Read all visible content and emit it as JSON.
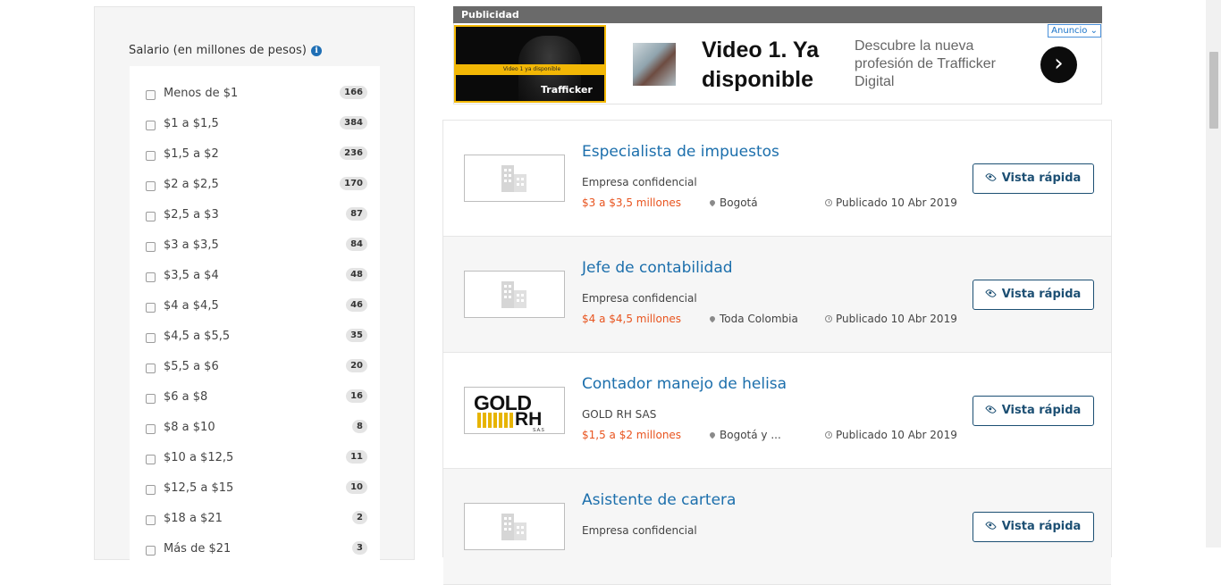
{
  "sidebar": {
    "salary_filter": {
      "title": "Salario (en millones de pesos)",
      "info_icon": "info-icon",
      "options": [
        {
          "label": "Menos de $1",
          "count": "166"
        },
        {
          "label": "$1 a $1,5",
          "count": "384"
        },
        {
          "label": "$1,5 a $2",
          "count": "236"
        },
        {
          "label": "$2 a $2,5",
          "count": "170"
        },
        {
          "label": "$2,5 a $3",
          "count": "87"
        },
        {
          "label": "$3 a $3,5",
          "count": "84"
        },
        {
          "label": "$3,5 a $4",
          "count": "48"
        },
        {
          "label": "$4 a $4,5",
          "count": "46"
        },
        {
          "label": "$4,5 a $5,5",
          "count": "35"
        },
        {
          "label": "$5,5 a $6",
          "count": "20"
        },
        {
          "label": "$6 a $8",
          "count": "16"
        },
        {
          "label": "$8 a $10",
          "count": "8"
        },
        {
          "label": "$10 a $12,5",
          "count": "11"
        },
        {
          "label": "$12,5 a $15",
          "count": "10"
        },
        {
          "label": "$18 a $21",
          "count": "2"
        },
        {
          "label": "Más de $21",
          "count": "3"
        }
      ]
    }
  },
  "ad": {
    "header": "Publicidad",
    "video_strip": "Video 1 ya disponible",
    "video_brand": "Trafficker",
    "headline": "Video 1. Ya disponible",
    "description": "Descubre la nueva profesión de Trafficker Digital",
    "badge": "Anuncio",
    "next_icon": "chevron-right-icon"
  },
  "jobs": [
    {
      "title": "Especialista de impuestos",
      "company": "Empresa confidencial",
      "salary": "$3 a $3,5 millones",
      "location": "Bogotá",
      "date": "Publicado 10 Abr 2019",
      "button": "Vista rápida",
      "logo": "building-icon"
    },
    {
      "title": "Jefe de contabilidad",
      "company": "Empresa confidencial",
      "salary": "$4 a $4,5 millones",
      "location": "Toda Colombia",
      "date": "Publicado 10 Abr 2019",
      "button": "Vista rápida",
      "logo": "building-icon"
    },
    {
      "title": "Contador manejo de helisa",
      "company": "GOLD RH SAS",
      "salary": "$1,5 a $2 millones",
      "location": "Bogotá y ...",
      "date": "Publicado 10 Abr 2019",
      "button": "Vista rápida",
      "logo": "gold-rh-logo",
      "logo_text": {
        "top": "GOLD",
        "right": "RH",
        "small": "S.A.S"
      }
    },
    {
      "title": "Asistente de cartera",
      "company": "Empresa confidencial",
      "salary": "",
      "location": "",
      "date": "",
      "button": "Vista rápida",
      "logo": "building-icon"
    }
  ],
  "colors": {
    "link": "#1c6fac",
    "salary": "#e8541f",
    "button_border": "#1c4f73",
    "ad_accent": "#f2b705"
  }
}
